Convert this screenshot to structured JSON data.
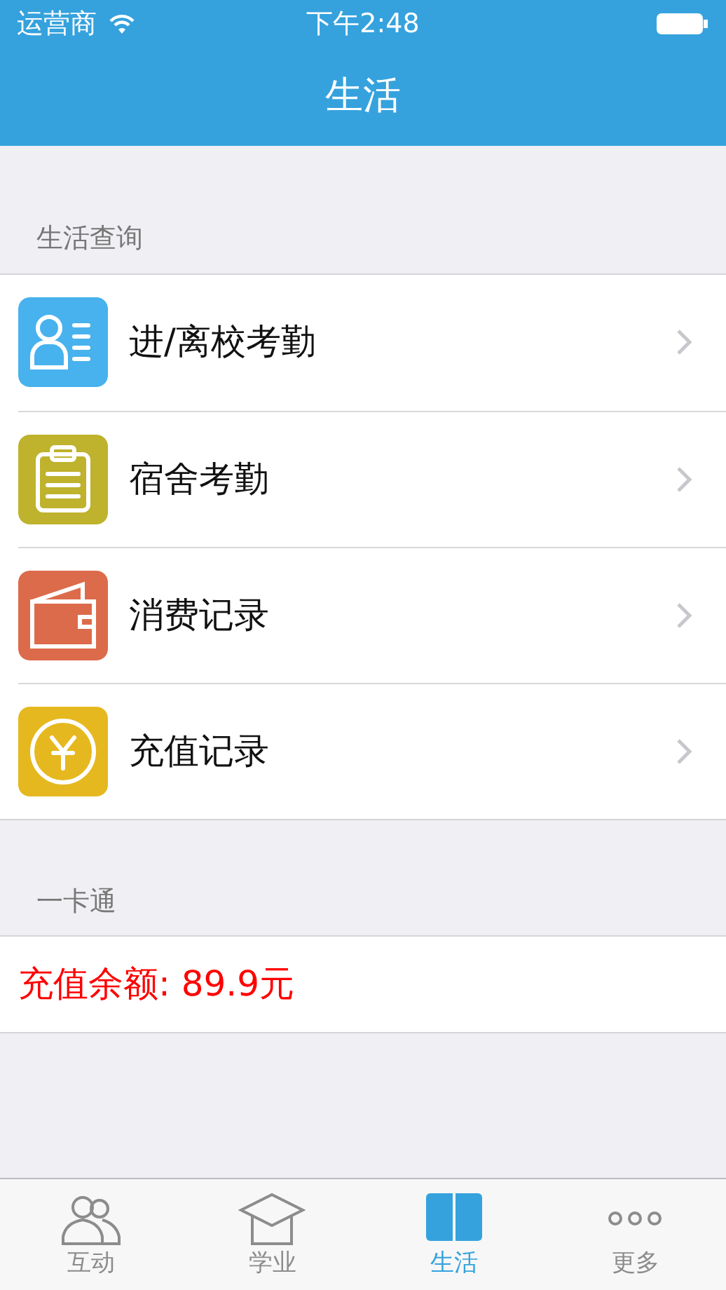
{
  "status_bar": {
    "carrier": "运营商",
    "time": "下午2:48"
  },
  "title": "生活",
  "query_section": {
    "header": "生活查询",
    "items": [
      {
        "label": "进/离校考勤",
        "color": "#47b2ed"
      },
      {
        "label": "宿舍考勤",
        "color": "#bfb22d"
      },
      {
        "label": "消费记录",
        "color": "#dc6b4c"
      },
      {
        "label": "充值记录",
        "color": "#e6b81f"
      }
    ]
  },
  "card_section": {
    "header": "一卡通",
    "balance": "充值余额: 89.9元"
  },
  "tabs": [
    {
      "label": "互动",
      "selected": false
    },
    {
      "label": "学业",
      "selected": false
    },
    {
      "label": "生活",
      "selected": true
    },
    {
      "label": "更多",
      "selected": false
    }
  ]
}
